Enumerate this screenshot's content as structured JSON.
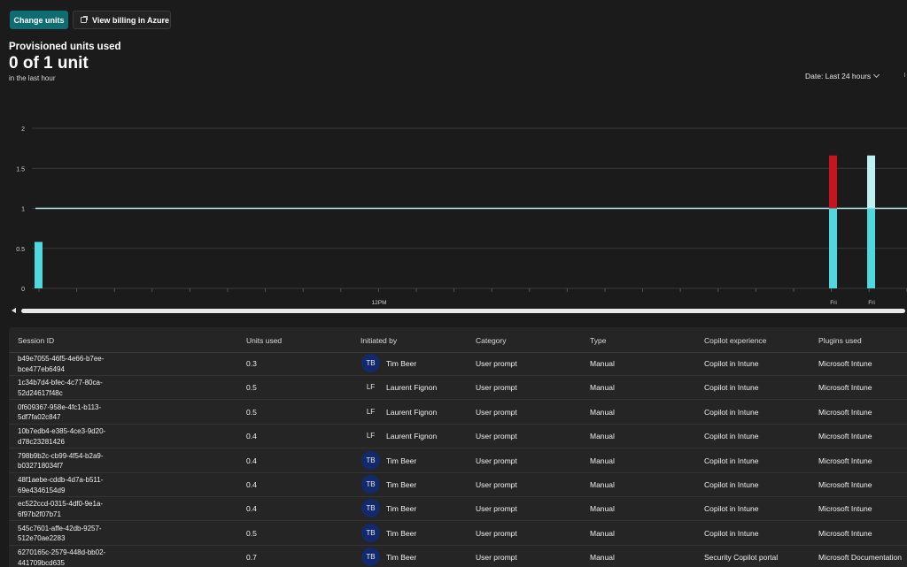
{
  "toolbar": {
    "change_units": "Change units",
    "view_billing": "View billing in Azure"
  },
  "summary": {
    "title": "Provisioned units used",
    "value": "0 of 1 unit",
    "period": "in the last hour"
  },
  "filter": {
    "date_label": "Date: Last 24 hours"
  },
  "colors": {
    "accent": "#0f6d72",
    "bar": "#4fd8de",
    "bar_light": "#bff0f2",
    "overage": "#c8141f"
  },
  "chart_data": {
    "type": "bar",
    "y_ticks": [
      "0",
      "0.5",
      "1",
      "1.5",
      "2"
    ],
    "ylim": [
      0,
      2
    ],
    "threshold": 1,
    "x_labels": [
      "12PM",
      "Fri",
      "Fri"
    ],
    "bars": [
      {
        "label": "",
        "value": 0.58,
        "overage": 0
      },
      {
        "label": "Fri",
        "value": 1.0,
        "overage": 0.66
      },
      {
        "label": "Fri",
        "value": 1.66,
        "overage": 0
      }
    ]
  },
  "table": {
    "headers": [
      "Session ID",
      "Units used",
      "Initiated by",
      "Category",
      "Type",
      "Copilot experience",
      "Plugins used"
    ],
    "rows": [
      {
        "id1": "b49e7055-46f5-4e66-b7ee-",
        "id2": "bce477eb6494",
        "units": "0.3",
        "initials": "TB",
        "name": "Tim Beer",
        "category": "User prompt",
        "type": "Manual",
        "experience": "Copilot in Intune",
        "plugin": "Microsoft Intune"
      },
      {
        "id1": "1c34b7d4-bfec-4c77-80ca-",
        "id2": "52d24617f48c",
        "units": "0.5",
        "initials": "LF",
        "name": "Laurent Fignon",
        "category": "User prompt",
        "type": "Manual",
        "experience": "Copilot in Intune",
        "plugin": "Microsoft Intune"
      },
      {
        "id1": "0f609367-958e-4fc1-b113-",
        "id2": "5df7fa02c847",
        "units": "0.5",
        "initials": "LF",
        "name": "Laurent Fignon",
        "category": "User prompt",
        "type": "Manual",
        "experience": "Copilot in Intune",
        "plugin": "Microsoft Intune"
      },
      {
        "id1": "10b7edb4-e385-4ce3-9d20-",
        "id2": "d78c23281426",
        "units": "0.4",
        "initials": "LF",
        "name": "Laurent Fignon",
        "category": "User prompt",
        "type": "Manual",
        "experience": "Copilot in Intune",
        "plugin": "Microsoft Intune"
      },
      {
        "id1": "798b9b2c-cb99-4f54-b2a9-",
        "id2": "b032718034f7",
        "units": "0.4",
        "initials": "TB",
        "name": "Tim Beer",
        "category": "User prompt",
        "type": "Manual",
        "experience": "Copilot in Intune",
        "plugin": "Microsoft Intune"
      },
      {
        "id1": "48f1aebe-cddb-4d7a-b511-",
        "id2": "69e4346154d9",
        "units": "0.4",
        "initials": "TB",
        "name": "Tim Beer",
        "category": "User prompt",
        "type": "Manual",
        "experience": "Copilot in Intune",
        "plugin": "Microsoft Intune"
      },
      {
        "id1": "ec522ccd-0315-4df0-9e1a-",
        "id2": "6f97b2f07b71",
        "units": "0.4",
        "initials": "TB",
        "name": "Tim Beer",
        "category": "User prompt",
        "type": "Manual",
        "experience": "Copilot in Intune",
        "plugin": "Microsoft Intune"
      },
      {
        "id1": "545c7601-affe-42db-9257-",
        "id2": "512e70ae2283",
        "units": "0.5",
        "initials": "TB",
        "name": "Tim Beer",
        "category": "User prompt",
        "type": "Manual",
        "experience": "Copilot in Intune",
        "plugin": "Microsoft Intune"
      },
      {
        "id1": "6270165c-2579-448d-bb02-",
        "id2": "441709bcd635",
        "units": "0.7",
        "initials": "TB",
        "name": "Tim Beer",
        "category": "User prompt",
        "type": "Manual",
        "experience": "Security Copilot portal",
        "plugin": "Microsoft Documentation"
      }
    ]
  }
}
